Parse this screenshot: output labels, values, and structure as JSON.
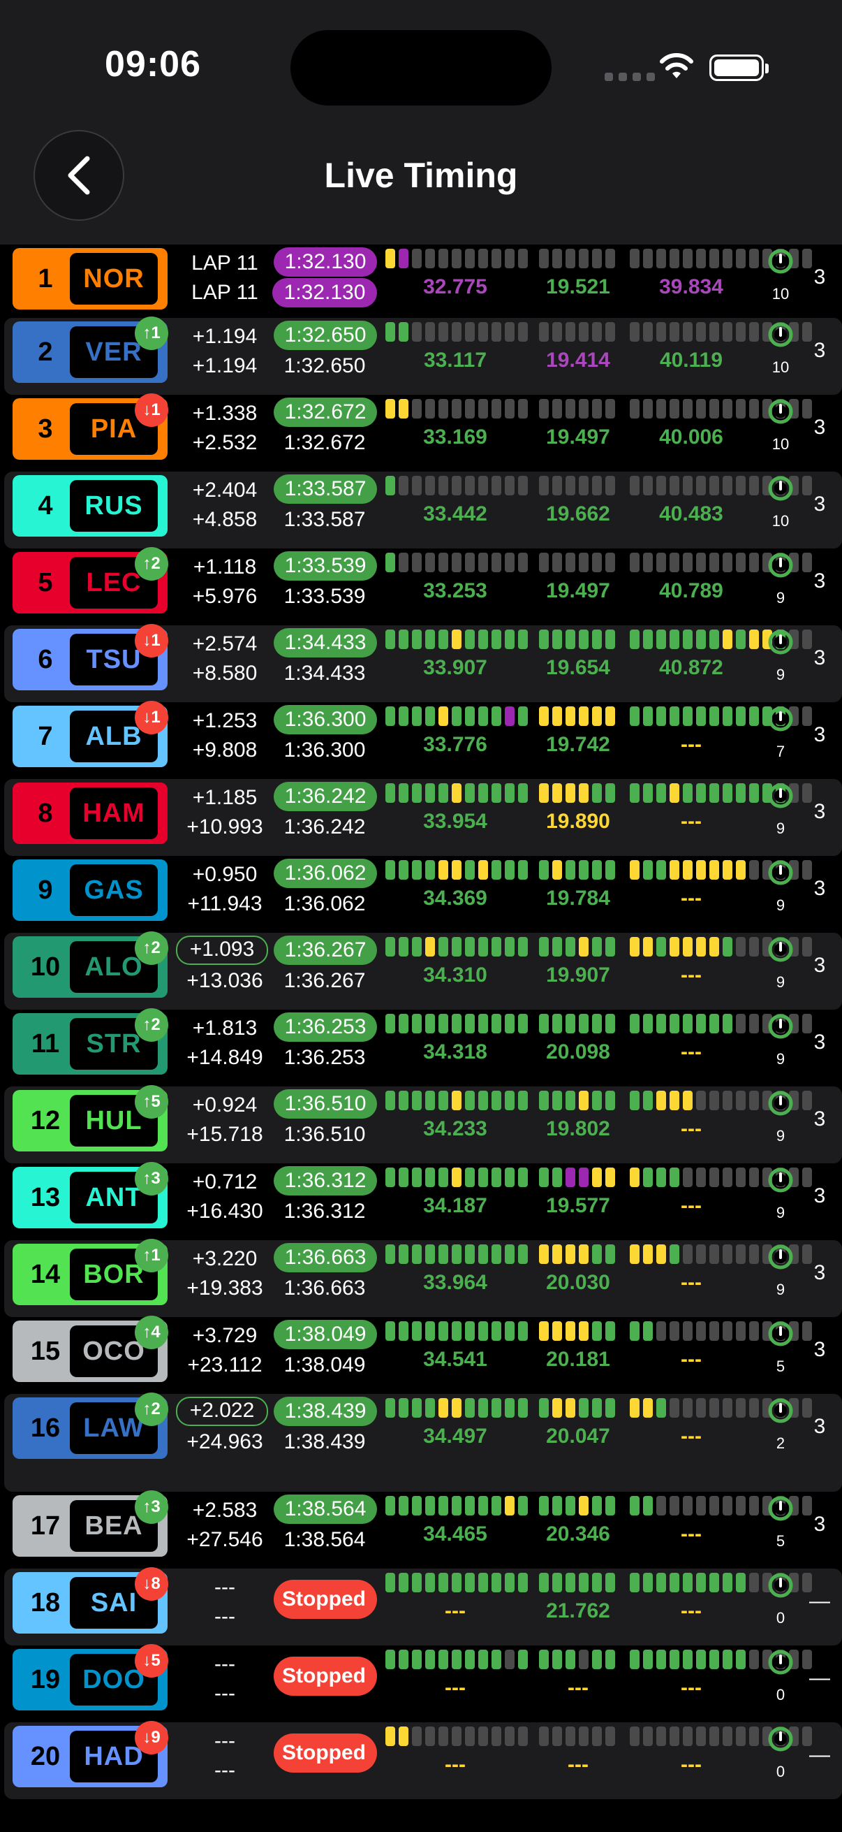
{
  "status_bar": {
    "time": "09:06"
  },
  "header": {
    "title": "Live Timing"
  },
  "drivers": [
    {
      "pos": "1",
      "tla": "NOR",
      "color": "#ff8000",
      "tla_color": "#ff8000",
      "badge": "",
      "dir": "",
      "gap": "LAP 11",
      "interval": "LAP 11",
      "gap_outlined": false,
      "best": "1:32.130",
      "best_purple": true,
      "last": "1:32.130",
      "last_purple": true,
      "segs": [
        "y",
        "p",
        "d",
        "d",
        "d",
        "d",
        "d",
        "d",
        "d",
        "d",
        "d",
        "d",
        "d",
        "d",
        "d",
        "d",
        "d",
        "d",
        "d",
        "d",
        "d",
        "d",
        "d",
        "d",
        "d",
        "d",
        "d",
        "d",
        "d",
        "d",
        "d"
      ],
      "s1": "32.775",
      "s1c": "purple",
      "s2": "19.521",
      "s2c": "green",
      "s3": "39.834",
      "s3c": "purple",
      "laps": "10",
      "pit": "3",
      "stopped": false,
      "shade": false
    },
    {
      "pos": "2",
      "tla": "VER",
      "color": "#3671c6",
      "tla_color": "#3671c6",
      "badge": "↑1",
      "dir": "up",
      "gap": "+1.194",
      "interval": "+1.194",
      "gap_outlined": false,
      "best": "1:32.650",
      "best_purple": false,
      "last": "1:32.650",
      "last_purple": false,
      "segs": [
        "g",
        "g",
        "d",
        "d",
        "d",
        "d",
        "d",
        "d",
        "d",
        "d",
        "d",
        "d",
        "d",
        "d",
        "d",
        "d",
        "d",
        "d",
        "d",
        "d",
        "d",
        "d",
        "d",
        "d",
        "d",
        "d",
        "d",
        "d",
        "d",
        "d",
        "d"
      ],
      "s1": "33.117",
      "s1c": "green",
      "s2": "19.414",
      "s2c": "purple",
      "s3": "40.119",
      "s3c": "green",
      "laps": "10",
      "pit": "3",
      "stopped": false,
      "shade": true
    },
    {
      "pos": "3",
      "tla": "PIA",
      "color": "#ff8000",
      "tla_color": "#ff8000",
      "badge": "↓1",
      "dir": "down",
      "gap": "+1.338",
      "interval": "+2.532",
      "gap_outlined": false,
      "best": "1:32.672",
      "best_purple": false,
      "last": "1:32.672",
      "last_purple": false,
      "segs": [
        "y",
        "y",
        "d",
        "d",
        "d",
        "d",
        "d",
        "d",
        "d",
        "d",
        "d",
        "d",
        "d",
        "d",
        "d",
        "d",
        "d",
        "d",
        "d",
        "d",
        "d",
        "d",
        "d",
        "d",
        "d",
        "d",
        "d",
        "d",
        "d",
        "d",
        "d"
      ],
      "s1": "33.169",
      "s1c": "green",
      "s2": "19.497",
      "s2c": "green",
      "s3": "40.006",
      "s3c": "green",
      "laps": "10",
      "pit": "3",
      "stopped": false,
      "shade": false
    },
    {
      "pos": "4",
      "tla": "RUS",
      "color": "#27f4d2",
      "tla_color": "#27f4d2",
      "badge": "",
      "dir": "",
      "gap": "+2.404",
      "interval": "+4.858",
      "gap_outlined": false,
      "best": "1:33.587",
      "best_purple": false,
      "last": "1:33.587",
      "last_purple": false,
      "segs": [
        "g",
        "d",
        "d",
        "d",
        "d",
        "d",
        "d",
        "d",
        "d",
        "d",
        "d",
        "d",
        "d",
        "d",
        "d",
        "d",
        "d",
        "d",
        "d",
        "d",
        "d",
        "d",
        "d",
        "d",
        "d",
        "d",
        "d",
        "d",
        "d",
        "d",
        "d"
      ],
      "s1": "33.442",
      "s1c": "green",
      "s2": "19.662",
      "s2c": "green",
      "s3": "40.483",
      "s3c": "green",
      "laps": "10",
      "pit": "3",
      "stopped": false,
      "shade": true
    },
    {
      "pos": "5",
      "tla": "LEC",
      "color": "#e8002d",
      "tla_color": "#e8002d",
      "badge": "↑2",
      "dir": "up",
      "gap": "+1.118",
      "interval": "+5.976",
      "gap_outlined": false,
      "best": "1:33.539",
      "best_purple": false,
      "last": "1:33.539",
      "last_purple": false,
      "segs": [
        "g",
        "d",
        "d",
        "d",
        "d",
        "d",
        "d",
        "d",
        "d",
        "d",
        "d",
        "d",
        "d",
        "d",
        "d",
        "d",
        "d",
        "d",
        "d",
        "d",
        "d",
        "d",
        "d",
        "d",
        "d",
        "d",
        "d",
        "d",
        "d",
        "d",
        "d"
      ],
      "s1": "33.253",
      "s1c": "green",
      "s2": "19.497",
      "s2c": "green",
      "s3": "40.789",
      "s3c": "green",
      "laps": "9",
      "pit": "3",
      "stopped": false,
      "shade": false
    },
    {
      "pos": "6",
      "tla": "TSU",
      "color": "#6692ff",
      "tla_color": "#6692ff",
      "badge": "↓1",
      "dir": "down",
      "gap": "+2.574",
      "interval": "+8.580",
      "gap_outlined": false,
      "best": "1:34.433",
      "best_purple": false,
      "last": "1:34.433",
      "last_purple": false,
      "segs": [
        "g",
        "g",
        "g",
        "g",
        "g",
        "y",
        "g",
        "g",
        "g",
        "g",
        "g",
        "g",
        "g",
        "g",
        "g",
        "g",
        "g",
        "g",
        "g",
        "g",
        "g",
        "g",
        "g",
        "g",
        "y",
        "g",
        "y",
        "y",
        "g"
      ],
      "s1": "33.907",
      "s1c": "green",
      "s2": "19.654",
      "s2c": "green",
      "s3": "40.872",
      "s3c": "green",
      "laps": "9",
      "pit": "3",
      "stopped": false,
      "shade": true
    },
    {
      "pos": "7",
      "tla": "ALB",
      "color": "#64c4ff",
      "tla_color": "#64c4ff",
      "badge": "↓1",
      "dir": "down",
      "gap": "+1.253",
      "interval": "+9.808",
      "gap_outlined": false,
      "best": "1:36.300",
      "best_purple": false,
      "last": "1:36.300",
      "last_purple": false,
      "segs": [
        "g",
        "g",
        "g",
        "g",
        "y",
        "g",
        "g",
        "g",
        "g",
        "p",
        "g",
        "y",
        "y",
        "y",
        "y",
        "y",
        "y",
        "g",
        "g",
        "g",
        "g",
        "g",
        "g",
        "g",
        "g",
        "g",
        "g",
        "g",
        "g",
        "d",
        "d"
      ],
      "s1": "33.776",
      "s1c": "green",
      "s2": "19.742",
      "s2c": "green",
      "s3": "---",
      "s3c": "yellow",
      "laps": "7",
      "pit": "3",
      "stopped": false,
      "shade": false
    },
    {
      "pos": "8",
      "tla": "HAM",
      "color": "#e8002d",
      "tla_color": "#e8002d",
      "badge": "",
      "dir": "",
      "gap": "+1.185",
      "interval": "+10.993",
      "gap_outlined": false,
      "best": "1:36.242",
      "best_purple": false,
      "last": "1:36.242",
      "last_purple": false,
      "segs": [
        "g",
        "g",
        "g",
        "g",
        "g",
        "y",
        "g",
        "g",
        "g",
        "g",
        "g",
        "y",
        "y",
        "y",
        "y",
        "g",
        "g",
        "g",
        "g",
        "g",
        "y",
        "g",
        "g",
        "g",
        "g",
        "g",
        "g",
        "g",
        "g",
        "d",
        "d"
      ],
      "s1": "33.954",
      "s1c": "green",
      "s2": "19.890",
      "s2c": "yellow",
      "s3": "---",
      "s3c": "yellow",
      "laps": "9",
      "pit": "3",
      "stopped": false,
      "shade": true
    },
    {
      "pos": "9",
      "tla": "GAS",
      "color": "#0093cc",
      "tla_color": "#0093cc",
      "badge": "",
      "dir": "",
      "gap": "+0.950",
      "interval": "+11.943",
      "gap_outlined": false,
      "best": "1:36.062",
      "best_purple": false,
      "last": "1:36.062",
      "last_purple": false,
      "segs": [
        "g",
        "g",
        "g",
        "g",
        "y",
        "y",
        "g",
        "y",
        "g",
        "g",
        "g",
        "g",
        "y",
        "g",
        "g",
        "g",
        "g",
        "y",
        "g",
        "g",
        "y",
        "y",
        "y",
        "y",
        "y",
        "y",
        "d",
        "d",
        "d",
        "d",
        "d"
      ],
      "s1": "34.369",
      "s1c": "green",
      "s2": "19.784",
      "s2c": "green",
      "s3": "---",
      "s3c": "yellow",
      "laps": "9",
      "pit": "3",
      "stopped": false,
      "shade": false
    },
    {
      "pos": "10",
      "tla": "ALO",
      "color": "#229971",
      "tla_color": "#229971",
      "badge": "↑2",
      "dir": "up",
      "gap": "+1.093",
      "interval": "+13.036",
      "gap_outlined": true,
      "best": "1:36.267",
      "best_purple": false,
      "last": "1:36.267",
      "last_purple": false,
      "segs": [
        "g",
        "g",
        "g",
        "y",
        "g",
        "g",
        "g",
        "g",
        "g",
        "g",
        "g",
        "g",
        "g",
        "g",
        "y",
        "g",
        "g",
        "y",
        "y",
        "g",
        "y",
        "y",
        "y",
        "y",
        "g",
        "d",
        "d",
        "d",
        "d",
        "d",
        "d"
      ],
      "s1": "34.310",
      "s1c": "green",
      "s2": "19.907",
      "s2c": "green",
      "s3": "---",
      "s3c": "yellow",
      "laps": "9",
      "pit": "3",
      "stopped": false,
      "shade": true
    },
    {
      "pos": "11",
      "tla": "STR",
      "color": "#229971",
      "tla_color": "#229971",
      "badge": "↑2",
      "dir": "up",
      "gap": "+1.813",
      "interval": "+14.849",
      "gap_outlined": false,
      "best": "1:36.253",
      "best_purple": false,
      "last": "1:36.253",
      "last_purple": false,
      "segs": [
        "g",
        "g",
        "g",
        "g",
        "g",
        "g",
        "g",
        "g",
        "g",
        "g",
        "g",
        "g",
        "g",
        "g",
        "g",
        "g",
        "g",
        "g",
        "g",
        "g",
        "g",
        "g",
        "g",
        "g",
        "g",
        "d",
        "d",
        "d",
        "d",
        "d",
        "d"
      ],
      "s1": "34.318",
      "s1c": "green",
      "s2": "20.098",
      "s2c": "green",
      "s3": "---",
      "s3c": "yellow",
      "laps": "9",
      "pit": "3",
      "stopped": false,
      "shade": false
    },
    {
      "pos": "12",
      "tla": "HUL",
      "color": "#52e252",
      "tla_color": "#52e252",
      "badge": "↑5",
      "dir": "up",
      "gap": "+0.924",
      "interval": "+15.718",
      "gap_outlined": false,
      "best": "1:36.510",
      "best_purple": false,
      "last": "1:36.510",
      "last_purple": false,
      "segs": [
        "g",
        "g",
        "g",
        "g",
        "g",
        "y",
        "g",
        "g",
        "g",
        "g",
        "g",
        "g",
        "g",
        "g",
        "y",
        "g",
        "g",
        "g",
        "g",
        "y",
        "y",
        "y",
        "d",
        "d",
        "d",
        "d",
        "d",
        "d",
        "d",
        "d",
        "d"
      ],
      "s1": "34.233",
      "s1c": "green",
      "s2": "19.802",
      "s2c": "green",
      "s3": "---",
      "s3c": "yellow",
      "laps": "9",
      "pit": "3",
      "stopped": false,
      "shade": true
    },
    {
      "pos": "13",
      "tla": "ANT",
      "color": "#27f4d2",
      "tla_color": "#27f4d2",
      "badge": "↑3",
      "dir": "up",
      "gap": "+0.712",
      "interval": "+16.430",
      "gap_outlined": false,
      "best": "1:36.312",
      "best_purple": false,
      "last": "1:36.312",
      "last_purple": false,
      "segs": [
        "g",
        "g",
        "g",
        "g",
        "g",
        "y",
        "g",
        "g",
        "g",
        "g",
        "g",
        "g",
        "g",
        "p",
        "p",
        "y",
        "y",
        "y",
        "g",
        "g",
        "g",
        "d",
        "d",
        "d",
        "d",
        "d",
        "d",
        "d",
        "d",
        "d",
        "d"
      ],
      "s1": "34.187",
      "s1c": "green",
      "s2": "19.577",
      "s2c": "green",
      "s3": "---",
      "s3c": "yellow",
      "laps": "9",
      "pit": "3",
      "stopped": false,
      "shade": false
    },
    {
      "pos": "14",
      "tla": "BOR",
      "color": "#52e252",
      "tla_color": "#52e252",
      "badge": "↑1",
      "dir": "up",
      "gap": "+3.220",
      "interval": "+19.383",
      "gap_outlined": false,
      "best": "1:36.663",
      "best_purple": false,
      "last": "1:36.663",
      "last_purple": false,
      "segs": [
        "g",
        "g",
        "g",
        "g",
        "g",
        "g",
        "g",
        "g",
        "g",
        "g",
        "g",
        "y",
        "y",
        "y",
        "y",
        "g",
        "g",
        "y",
        "y",
        "y",
        "g",
        "d",
        "d",
        "d",
        "d",
        "d",
        "d",
        "d",
        "d",
        "d",
        "d"
      ],
      "s1": "33.964",
      "s1c": "green",
      "s2": "20.030",
      "s2c": "green",
      "s3": "---",
      "s3c": "yellow",
      "laps": "9",
      "pit": "3",
      "stopped": false,
      "shade": true
    },
    {
      "pos": "15",
      "tla": "OCO",
      "color": "#b6babd",
      "tla_color": "#b6babd",
      "badge": "↑4",
      "dir": "up",
      "gap": "+3.729",
      "interval": "+23.112",
      "gap_outlined": false,
      "best": "1:38.049",
      "best_purple": false,
      "last": "1:38.049",
      "last_purple": false,
      "segs": [
        "g",
        "g",
        "g",
        "g",
        "g",
        "g",
        "g",
        "g",
        "g",
        "g",
        "g",
        "y",
        "y",
        "y",
        "y",
        "g",
        "g",
        "g",
        "g",
        "d",
        "d",
        "d",
        "d",
        "d",
        "d",
        "d",
        "d",
        "d",
        "d",
        "d",
        "d"
      ],
      "s1": "34.541",
      "s1c": "green",
      "s2": "20.181",
      "s2c": "green",
      "s3": "---",
      "s3c": "yellow",
      "laps": "5",
      "pit": "3",
      "stopped": false,
      "shade": false
    },
    {
      "pos": "16",
      "tla": "LAW",
      "color": "#3671c6",
      "tla_color": "#3671c6",
      "badge": "↑2",
      "dir": "up",
      "gap": "+2.022",
      "interval": "+24.963",
      "gap_outlined": true,
      "best": "1:38.439",
      "best_purple": false,
      "last": "1:38.439",
      "last_purple": false,
      "segs": [
        "g",
        "g",
        "g",
        "g",
        "y",
        "y",
        "g",
        "g",
        "g",
        "g",
        "g",
        "g",
        "y",
        "y",
        "g",
        "g",
        "g",
        "y",
        "y",
        "g",
        "d",
        "d",
        "d",
        "d",
        "d",
        "d",
        "d",
        "d",
        "d",
        "d",
        "d"
      ],
      "s1": "34.497",
      "s1c": "green",
      "s2": "20.047",
      "s2c": "green",
      "s3": "---",
      "s3c": "yellow",
      "laps": "2",
      "pit": "3",
      "stopped": false,
      "shade": true
    },
    {
      "pos": "17",
      "tla": "BEA",
      "color": "#b6babd",
      "tla_color": "#b6babd",
      "badge": "↑3",
      "dir": "up",
      "gap": "+2.583",
      "interval": "+27.546",
      "gap_outlined": false,
      "best": "1:38.564",
      "best_purple": false,
      "last": "1:38.564",
      "last_purple": false,
      "segs": [
        "g",
        "g",
        "g",
        "g",
        "g",
        "g",
        "g",
        "g",
        "g",
        "y",
        "g",
        "g",
        "g",
        "g",
        "y",
        "g",
        "g",
        "g",
        "g",
        "d",
        "d",
        "d",
        "d",
        "d",
        "d",
        "d",
        "d",
        "d",
        "d",
        "d",
        "d"
      ],
      "s1": "34.465",
      "s1c": "green",
      "s2": "20.346",
      "s2c": "green",
      "s3": "---",
      "s3c": "yellow",
      "laps": "5",
      "pit": "3",
      "stopped": false,
      "shade": false
    },
    {
      "pos": "18",
      "tla": "SAI",
      "color": "#64c4ff",
      "tla_color": "#64c4ff",
      "badge": "↓8",
      "dir": "down",
      "gap": "---",
      "interval": "---",
      "gap_outlined": false,
      "best": "Stopped",
      "best_purple": false,
      "last": "",
      "last_purple": false,
      "segs": [
        "g",
        "g",
        "g",
        "g",
        "g",
        "g",
        "g",
        "g",
        "g",
        "g",
        "g",
        "g",
        "g",
        "g",
        "g",
        "g",
        "g",
        "g",
        "g",
        "g",
        "g",
        "g",
        "g",
        "g",
        "g",
        "g",
        "d"
      ],
      "s1": "---",
      "s1c": "yellow",
      "s2": "21.762",
      "s2c": "green",
      "s3": "---",
      "s3c": "yellow",
      "laps": "0",
      "pit": "—",
      "stopped": true,
      "shade": true
    },
    {
      "pos": "19",
      "tla": "DOO",
      "color": "#0093cc",
      "tla_color": "#0093cc",
      "badge": "↓5",
      "dir": "down",
      "gap": "---",
      "interval": "---",
      "gap_outlined": false,
      "best": "Stopped",
      "best_purple": false,
      "last": "",
      "last_purple": false,
      "segs": [
        "g",
        "g",
        "g",
        "g",
        "g",
        "g",
        "g",
        "g",
        "g",
        "d",
        "g",
        "g",
        "g",
        "g",
        "d",
        "g",
        "g",
        "g",
        "g",
        "g",
        "g",
        "g",
        "g",
        "g",
        "g",
        "g",
        "d"
      ],
      "s1": "---",
      "s1c": "yellow",
      "s2": "---",
      "s2c": "yellow",
      "s3": "---",
      "s3c": "yellow",
      "laps": "0",
      "pit": "—",
      "stopped": true,
      "shade": false
    },
    {
      "pos": "20",
      "tla": "HAD",
      "color": "#6692ff",
      "tla_color": "#6692ff",
      "badge": "↓9",
      "dir": "down",
      "gap": "---",
      "interval": "---",
      "gap_outlined": false,
      "best": "Stopped",
      "best_purple": false,
      "last": "",
      "last_purple": false,
      "segs": [
        "y",
        "y",
        "d",
        "d",
        "d",
        "d",
        "d",
        "d",
        "d",
        "d",
        "d",
        "d",
        "d",
        "d",
        "d",
        "d",
        "d",
        "d",
        "d",
        "d",
        "d",
        "d",
        "d",
        "d",
        "d",
        "d",
        "d",
        "d",
        "d",
        "d",
        "d"
      ],
      "s1": "---",
      "s1c": "yellow",
      "s2": "---",
      "s2c": "yellow",
      "s3": "---",
      "s3c": "yellow",
      "laps": "0",
      "pit": "—",
      "stopped": true,
      "shade": true
    }
  ]
}
